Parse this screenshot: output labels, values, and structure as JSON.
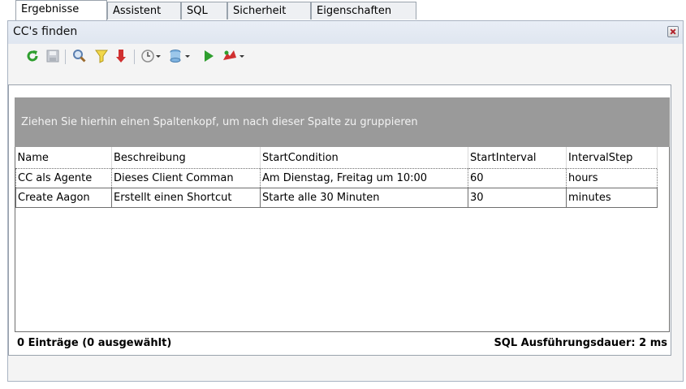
{
  "window": {
    "title": "CC's finden"
  },
  "toolbar": {
    "icons": [
      "refresh-icon",
      "save-icon",
      "find-icon",
      "filter-icon",
      "sort-icon",
      "clock-icon",
      "database-icon",
      "run-icon",
      "tools-icon"
    ]
  },
  "tabs": [
    {
      "label": "Ergebnisse",
      "active": true
    },
    {
      "label": "Assistent"
    },
    {
      "label": "SQL"
    },
    {
      "label": "Sicherheit"
    },
    {
      "label": "Eigenschaften"
    }
  ],
  "group_panel": {
    "text": "Ziehen Sie hierhin einen Spaltenkopf, um nach dieser Spalte zu gruppieren"
  },
  "table": {
    "columns": [
      "Name",
      "Beschreibung",
      "StartCondition",
      "StartInterval",
      "IntervalStep"
    ],
    "rows": [
      [
        "CC als Agente",
        "Dieses Client Comman",
        "Am Dienstag, Freitag um 10:00",
        "60",
        "hours"
      ],
      [
        "Create Aagon",
        "Erstellt einen Shortcut",
        "Starte alle 30 Minuten",
        "30",
        "minutes"
      ]
    ]
  },
  "footer": {
    "count": "0 Einträge (0 ausgewählt)",
    "duration": "SQL Ausführungsdauer: 2 ms"
  },
  "colors": {
    "group_bg": "#9a9a9a",
    "title_bg": "#e5eaf2",
    "accent_green": "#2e9e2e",
    "accent_red": "#d03030"
  }
}
